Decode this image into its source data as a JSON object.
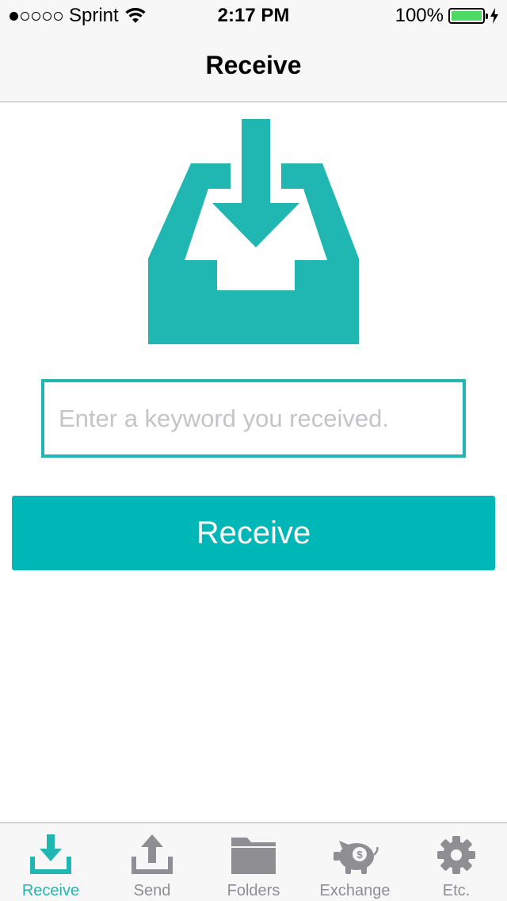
{
  "status_bar": {
    "carrier": "Sprint",
    "time": "2:17 PM",
    "battery_percent": "100%",
    "signal_bars_filled": 1,
    "signal_bars_total": 5
  },
  "nav": {
    "title": "Receive"
  },
  "keyword_input": {
    "placeholder": "Enter a keyword you received.",
    "value": ""
  },
  "receive_button": {
    "label": "Receive"
  },
  "tabs": [
    {
      "label": "Receive",
      "icon": "receive-icon",
      "active": true
    },
    {
      "label": "Send",
      "icon": "send-icon",
      "active": false
    },
    {
      "label": "Folders",
      "icon": "folder-icon",
      "active": false
    },
    {
      "label": "Exchange",
      "icon": "piggy-bank-icon",
      "active": false
    },
    {
      "label": "Etc.",
      "icon": "gear-icon",
      "active": false
    }
  ],
  "colors": {
    "accent": "#20b7b2",
    "button": "#00b7b8",
    "inactive": "#8e8e93",
    "battery": "#4cd964"
  }
}
